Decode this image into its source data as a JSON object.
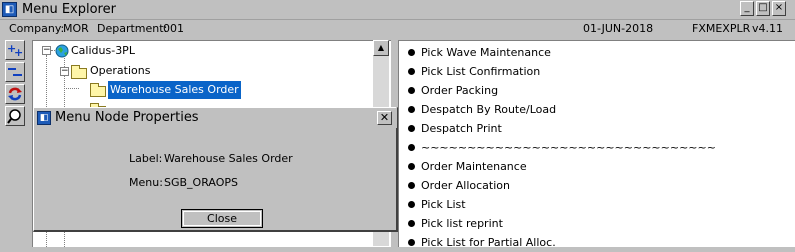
{
  "window": {
    "title": "Menu Explorer",
    "controls": {
      "minimize": "_",
      "maximize": "□",
      "close": "×"
    }
  },
  "infobar": {
    "company_label": "Company:",
    "company_value": "MOR",
    "department_label": "Department:",
    "department_value": "001",
    "date": "01-JUN-2018",
    "program": "FXMEXPLR",
    "version": "v4.11"
  },
  "toolbar": {
    "tools": [
      {
        "icon": "expand-all-icon"
      },
      {
        "icon": "collapse-all-icon"
      },
      {
        "icon": "refresh-icon"
      },
      {
        "icon": "search-icon"
      }
    ]
  },
  "tree": {
    "root_label": "Calidus-3PL",
    "operations_label": "Operations",
    "selected_label": "Warehouse Sales Order"
  },
  "menu_list": {
    "items": [
      "Pick Wave Maintenance",
      "Pick List Confirmation",
      "Order Packing",
      "Despatch By Route/Load",
      "Despatch Print",
      "~~~~~~~~~~~~~~~~~~~~~~~~~~~~~~~~",
      "Order Maintenance",
      "Order Allocation",
      "Pick List",
      "Pick list reprint",
      "Pick List for Partial Alloc."
    ]
  },
  "dialog": {
    "title": "Menu Node Properties",
    "label_caption": "Label:",
    "label_value": "Warehouse Sales Order",
    "menu_caption": "Menu:",
    "menu_value": "SGB_ORAOPS",
    "close_button": "Close"
  }
}
